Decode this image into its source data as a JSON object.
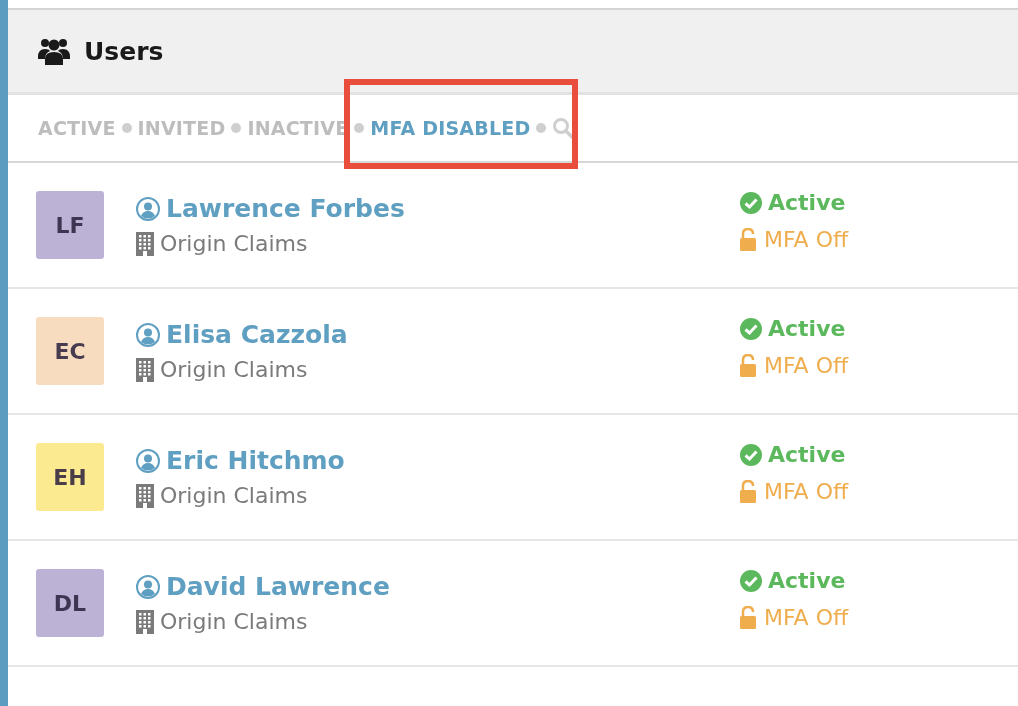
{
  "panel": {
    "title": "Users"
  },
  "filters": [
    {
      "label": "ACTIVE",
      "selected": false,
      "highlighted": false
    },
    {
      "label": "INVITED",
      "selected": false,
      "highlighted": false
    },
    {
      "label": "INACTIVE",
      "selected": false,
      "highlighted": false
    },
    {
      "label": "MFA DISABLED",
      "selected": true,
      "highlighted": true
    }
  ],
  "users": [
    {
      "initials": "LF",
      "color": "#bcb2d6",
      "name": "Lawrence Forbes",
      "company": "Origin Claims",
      "status": "Active",
      "mfa": "MFA Off"
    },
    {
      "initials": "EC",
      "color": "#f8dcc0",
      "name": "Elisa Cazzola",
      "company": "Origin Claims",
      "status": "Active",
      "mfa": "MFA Off"
    },
    {
      "initials": "EH",
      "color": "#fbea90",
      "name": "Eric Hitchmo",
      "company": "Origin Claims",
      "status": "Active",
      "mfa": "MFA Off"
    },
    {
      "initials": "DL",
      "color": "#bcb2d6",
      "name": "David Lawrence",
      "company": "Origin Claims",
      "status": "Active",
      "mfa": "MFA Off"
    }
  ]
}
